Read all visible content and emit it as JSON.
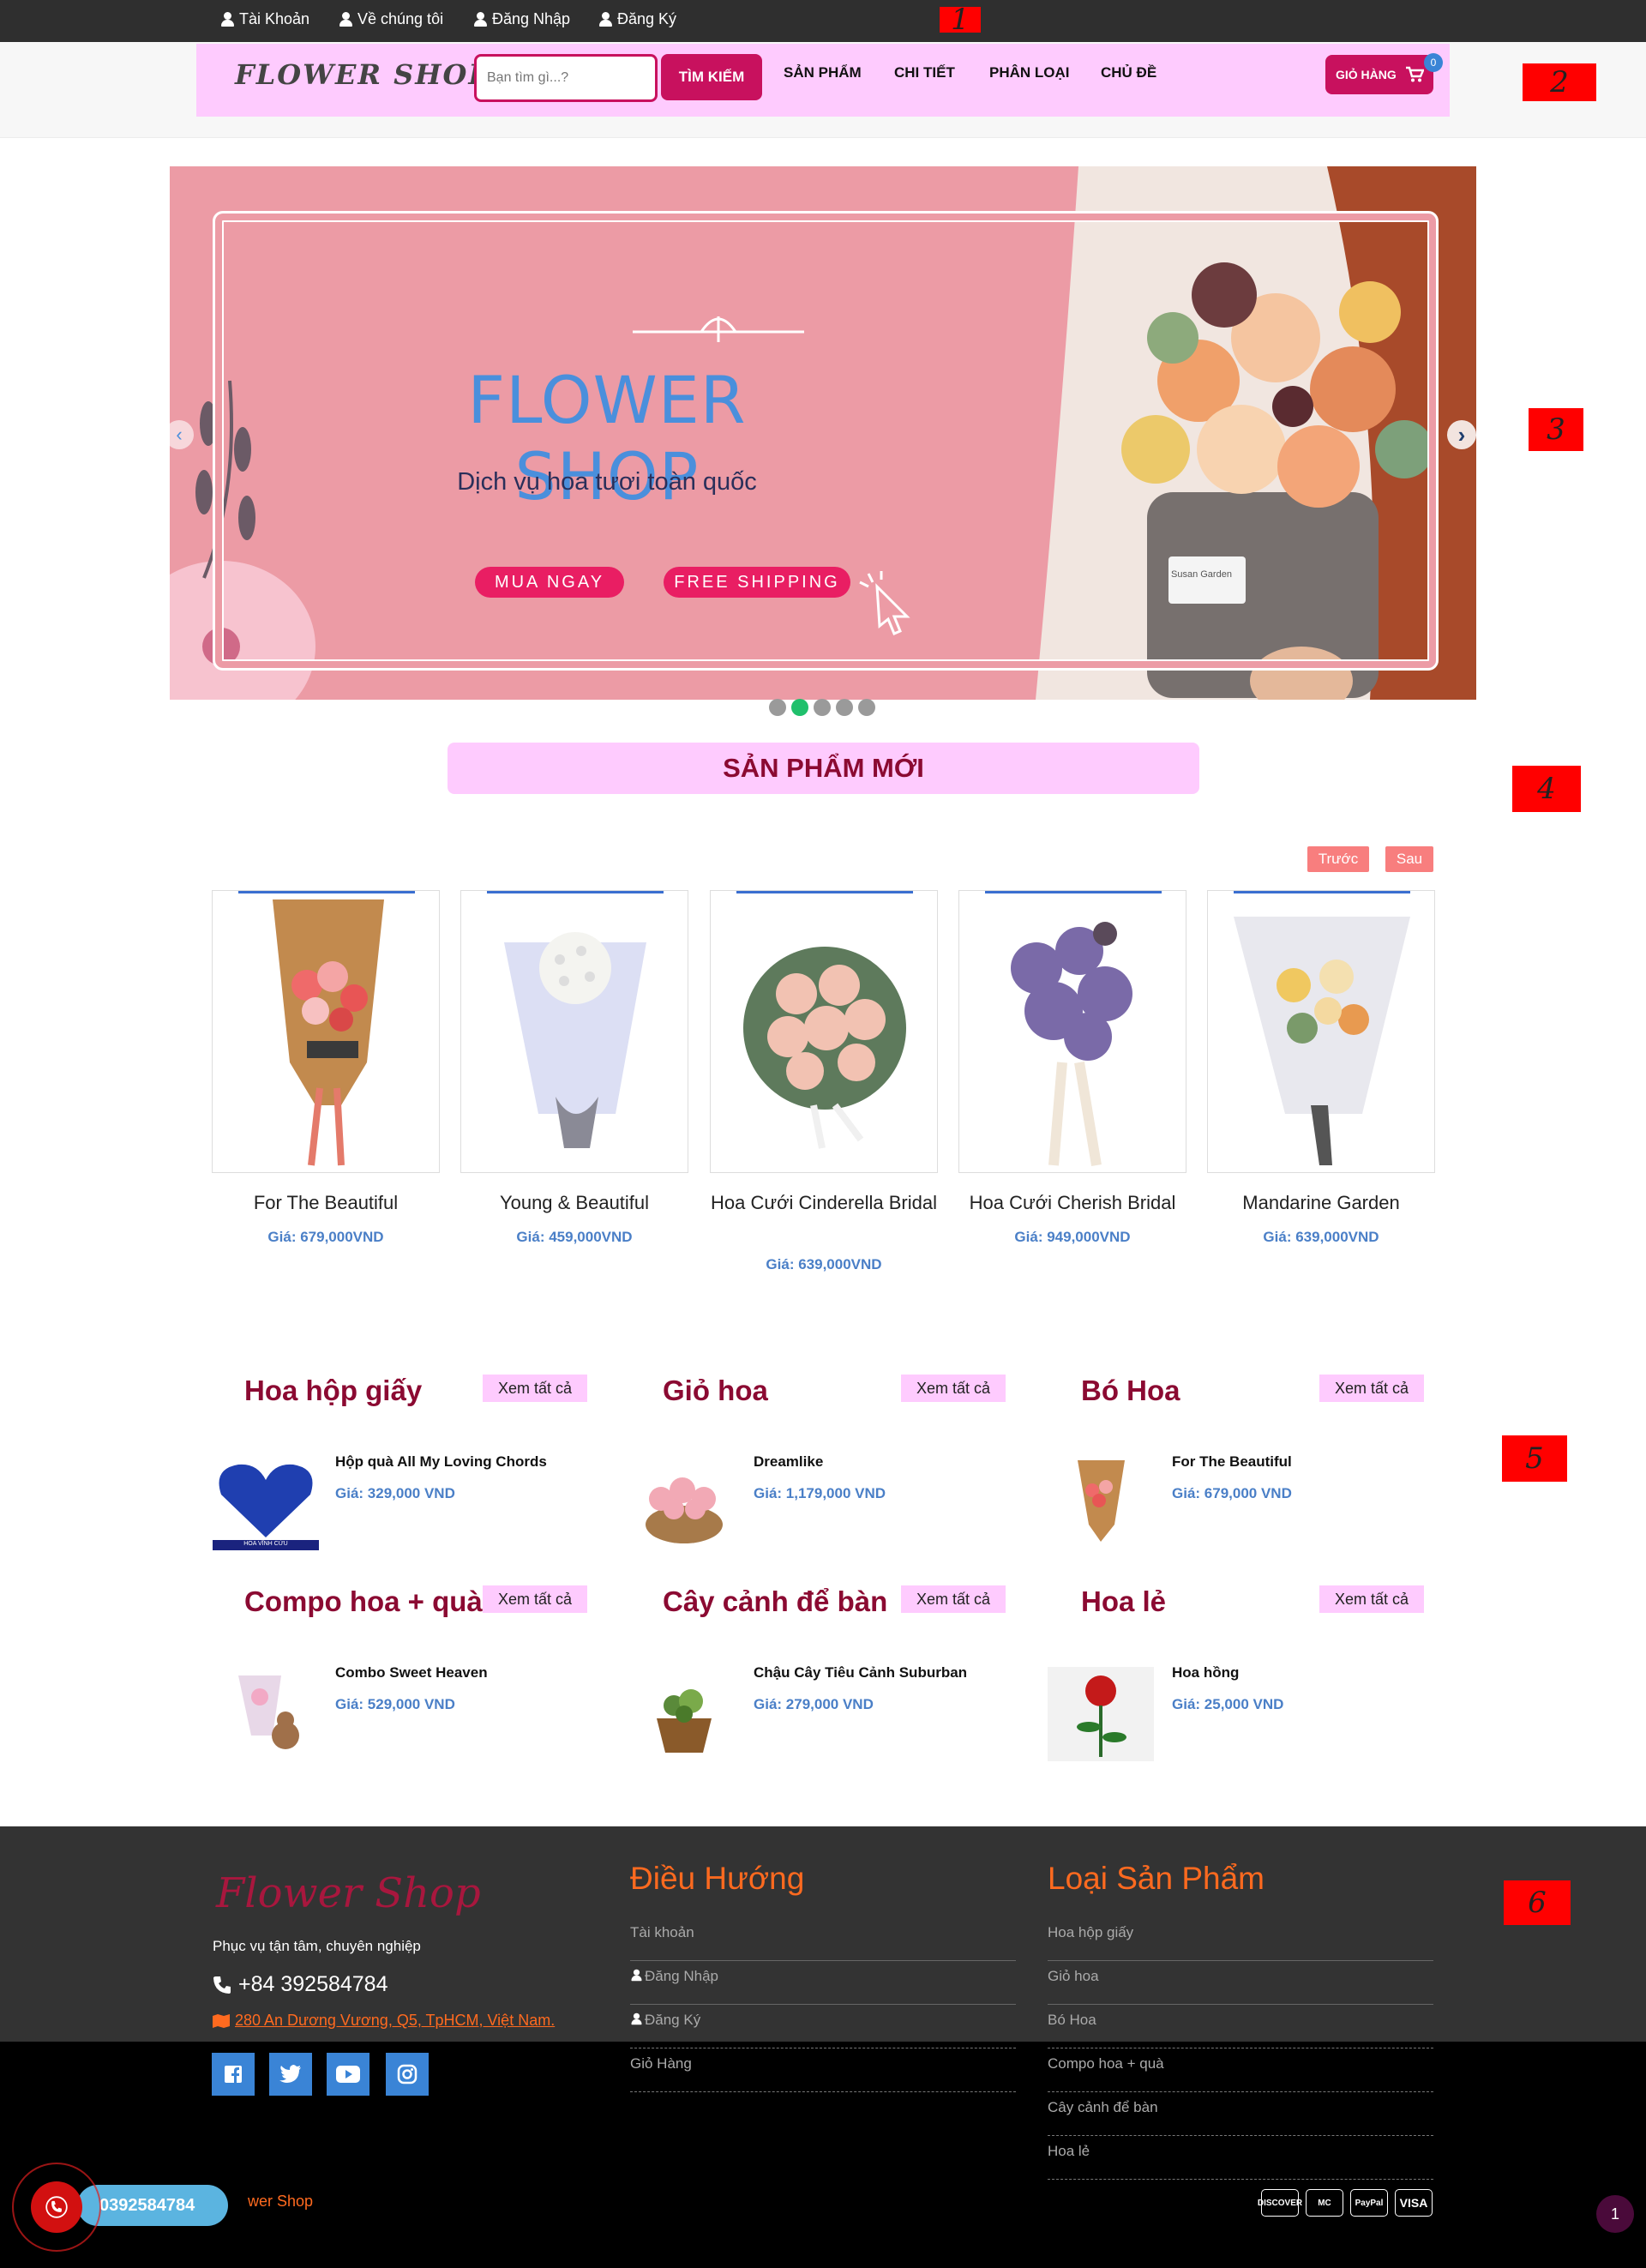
{
  "topbar": {
    "links": [
      "Tài Khoản",
      "Về chúng tôi",
      "Đăng Nhập",
      "Đăng Ký"
    ]
  },
  "markers": [
    "1",
    "2",
    "3",
    "4",
    "5",
    "6"
  ],
  "header": {
    "logo": "FLOWER SHOP",
    "search_placeholder": "Bạn tìm gì...?",
    "search_button": "TÌM KIẾM",
    "menu": [
      "SẢN PHẨM",
      "CHI TIẾT",
      "PHÂN LOẠI",
      "CHỦ ĐỀ"
    ],
    "cart_label": "GIỎ HÀNG",
    "cart_count": "0"
  },
  "slider": {
    "title": "FLOWER SHOP",
    "subtitle": "Dịch vụ hoa tươi toàn quốc",
    "buy_button": "MUA NGAY",
    "shipping_button": "FREE SHIPPING",
    "pot_label": "Susan Garden",
    "slide_count": 5,
    "active_slide": 2
  },
  "new_products": {
    "title": "SẢN PHẨM MỚI",
    "prev": "Trước",
    "next": "Sau",
    "items": [
      {
        "name": "For The Beautiful",
        "price": "Giá: 679,000VND"
      },
      {
        "name": "Young & Beautiful",
        "price": "Giá: 459,000VND"
      },
      {
        "name": "Hoa Cưới Cinderella Bridal",
        "price": "Giá: 639,000VND"
      },
      {
        "name": "Hoa Cưới Cherish Bridal",
        "price": "Giá: 949,000VND"
      },
      {
        "name": "Mandarine Garden",
        "price": "Giá: 639,000VND"
      }
    ]
  },
  "categories": {
    "see_all": "Xem tất cả",
    "items": [
      {
        "title": "Hoa hộp giấy",
        "product": "Hộp quà All My Loving Chords",
        "price": "Giá: 329,000 VND",
        "thumb_caption": "HOA VĨNH CỬU"
      },
      {
        "title": "Giỏ hoa",
        "product": "Dreamlike",
        "price": "Giá: 1,179,000 VND"
      },
      {
        "title": "Bó Hoa",
        "product": "For The Beautiful",
        "price": "Giá: 679,000 VND"
      },
      {
        "title": "Compo hoa + quà",
        "product": "Combo Sweet Heaven",
        "price": "Giá: 529,000 VND"
      },
      {
        "title": "Cây cảnh để bàn",
        "product": "Chậu Cây Tiêu Cảnh Suburban",
        "price": "Giá: 279,000 VND"
      },
      {
        "title": "Hoa lẻ",
        "product": "Hoa hồng",
        "price": "Giá: 25,000 VND"
      }
    ]
  },
  "footer": {
    "logo": "Flower Shop",
    "tagline": "Phục vụ tận tâm, chuyên nghiệp",
    "phone": "+84 392584784",
    "address": "280 An Dương Vương, Q5, TpHCM, Việt Nam.",
    "nav_title": "Điều Hướng",
    "nav_links": [
      "Tài khoản",
      "Đăng Nhập",
      "Đăng Ký",
      "Giỏ Hàng"
    ],
    "types_title": "Loại Sản Phẩm",
    "types_links": [
      "Hoa hộp giấy",
      "Giỏ hoa",
      "Bó Hoa",
      "Compo hoa + quà",
      "Cây cảnh để bàn",
      "Hoa lẻ"
    ],
    "copyright": "wer Shop",
    "hotline": "0392584784",
    "payments": [
      "DISCOVER",
      "MC",
      "PayPal",
      "VISA"
    ],
    "page_badge": "1"
  },
  "colors": {
    "brand_pink": "#fecbfe",
    "brand_crimson": "#c8115e",
    "title_maroon": "#8b0a32",
    "price_blue": "#4a7fc7",
    "footer_orange": "#ff6a1f"
  }
}
